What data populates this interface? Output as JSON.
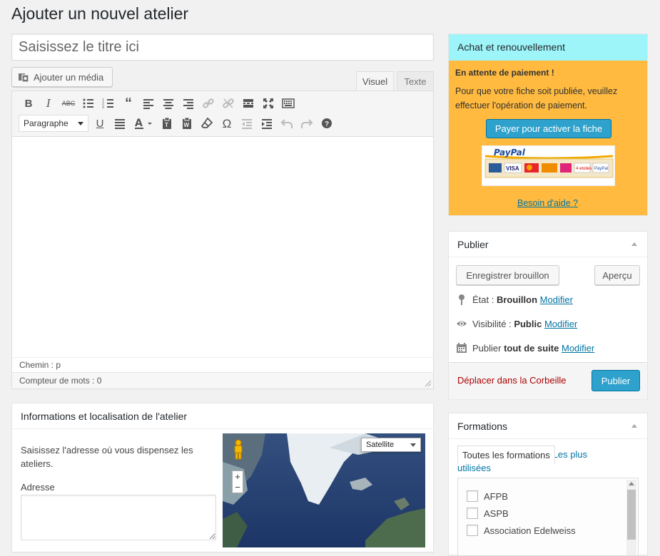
{
  "page": {
    "title": "Ajouter un nouvel atelier"
  },
  "editor": {
    "title_placeholder": "Saisissez le titre ici",
    "add_media_label": "Ajouter un média",
    "tabs": {
      "visual": "Visuel",
      "text": "Texte"
    },
    "format_select": "Paragraphe",
    "path": "Chemin : p",
    "word_count": "Compteur de mots : 0"
  },
  "info_box": {
    "title": "Informations et localisation de l'atelier",
    "description": "Saisissez l'adresse où vous dispensez les ateliers.",
    "address_label": "Adresse",
    "map_type": "Satellite"
  },
  "achat": {
    "title": "Achat et renouvellement",
    "status": "En attente de paiement !",
    "message": "Pour que votre fiche soit publiée, veuillez effectuer l'opération de paiement.",
    "pay_button": "Payer pour activer la fiche",
    "paypal_label": "PayPal",
    "help_link": "Besoin d'aide ?",
    "header_color": "#9ef5f9",
    "body_color": "#ffba3f"
  },
  "publish": {
    "title": "Publier",
    "save_draft": "Enregistrer brouillon",
    "preview": "Aperçu",
    "status_label": "État :",
    "status_value": "Brouillon",
    "visibility_label": "Visibilité :",
    "visibility_value": "Public",
    "schedule_label": "Publier",
    "schedule_value": "tout de suite",
    "modify": "Modifier",
    "trash": "Déplacer dans la Corbeille",
    "publish_button": "Publier",
    "primary_color": "#2ea2cc"
  },
  "formations": {
    "title": "Formations",
    "tab_all": "Toutes les formations",
    "tab_popular": "Les plus utilisées",
    "items": [
      "AFPB",
      "ASPB",
      "Association Edelweiss"
    ]
  }
}
